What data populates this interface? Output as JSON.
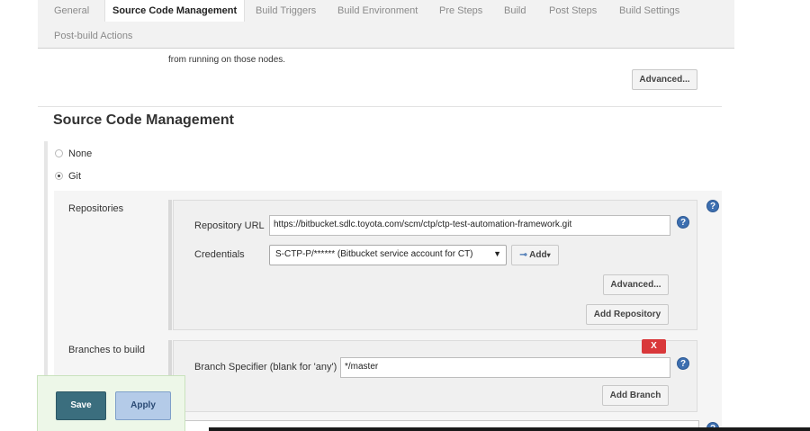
{
  "tabs": {
    "items": [
      {
        "label": "General"
      },
      {
        "label": "Source Code Management"
      },
      {
        "label": "Build Triggers"
      },
      {
        "label": "Build Environment"
      },
      {
        "label": "Pre Steps"
      },
      {
        "label": "Build"
      },
      {
        "label": "Post Steps"
      },
      {
        "label": "Build Settings"
      },
      {
        "label": "Post-build Actions"
      }
    ],
    "active": "Source Code Management"
  },
  "previous_section": {
    "text": "from running on those nodes.",
    "advanced_label": "Advanced..."
  },
  "scm": {
    "title": "Source Code Management",
    "options": [
      {
        "label": "None",
        "checked": false
      },
      {
        "label": "Git",
        "checked": true
      }
    ],
    "repositories": {
      "label": "Repositories",
      "repository_url_label": "Repository URL",
      "repository_url_value": "https://bitbucket.sdlc.toyota.com/scm/ctp/ctp-test-automation-framework.git",
      "credentials_label": "Credentials",
      "credentials_value": "S-CTP-P/****** (Bitbucket service account for CT)",
      "add_label": "Add",
      "advanced_label": "Advanced...",
      "add_repository_label": "Add Repository"
    },
    "branches": {
      "label": "Branches to build",
      "delete_label": "X",
      "branch_specifier_label": "Branch Specifier (blank for 'any')",
      "branch_specifier_value": "*/master",
      "add_branch_label": "Add Branch"
    }
  },
  "footer": {
    "save_label": "Save",
    "apply_label": "Apply"
  },
  "icons": {
    "help": "help-icon",
    "key": "key-icon",
    "caret": "caret-down-icon"
  },
  "colors": {
    "save_bg": "#3b6e7e",
    "apply_bg": "#b4cbe8",
    "delete_bg": "#d9383a",
    "help_bg": "#3d6fb0"
  }
}
